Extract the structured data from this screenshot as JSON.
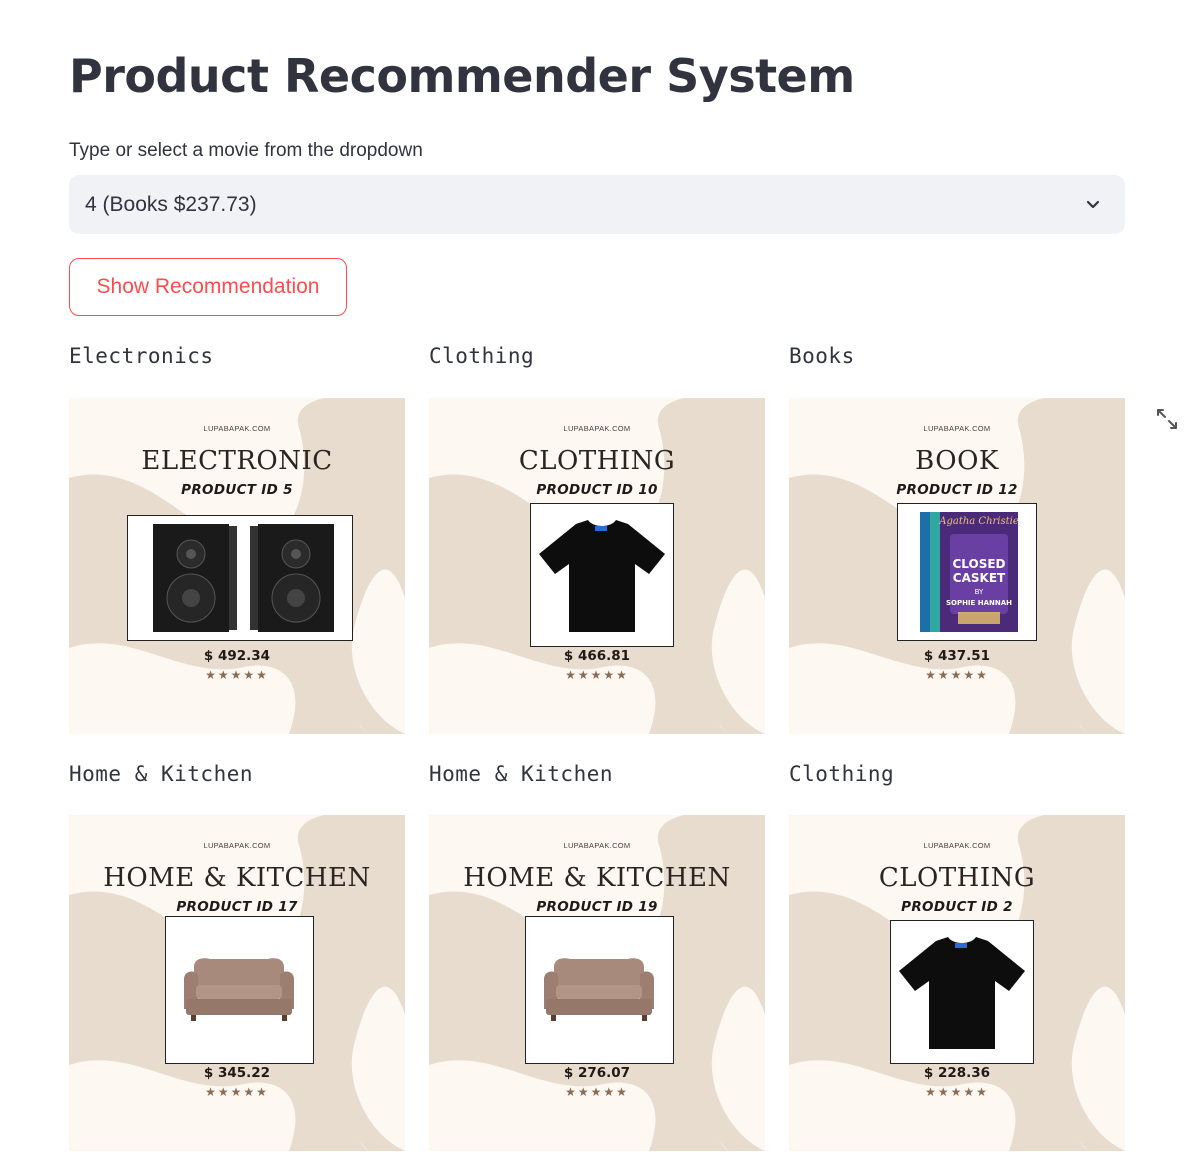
{
  "page": {
    "title": "Product Recommender System",
    "select_label": "Type or select a movie from the dropdown",
    "select_value": "4 (Books $237.73)",
    "button_label": "Show Recommendation"
  },
  "colors": {
    "accent": "#ff4b4b",
    "card_background": "#fdf8f2",
    "card_shape": "#e8dccf",
    "star": "#8a6b55"
  },
  "recommendations": [
    {
      "label": "Electronics",
      "site": "LUPABAPAK.COM",
      "category": "ELECTRONIC",
      "product_id": "PRODUCT ID 5",
      "price": "$ 492.34",
      "stars": "★★★★★",
      "image": "speakers"
    },
    {
      "label": "Clothing",
      "site": "LUPABAPAK.COM",
      "category": "CLOTHING",
      "product_id": "PRODUCT ID 10",
      "price": "$ 466.81",
      "stars": "★★★★★",
      "image": "t-shirt"
    },
    {
      "label": "Books",
      "site": "LUPABAPAK.COM",
      "category": "BOOK",
      "product_id": "PRODUCT ID 12",
      "price": "$ 437.51",
      "stars": "★★★★★",
      "image": "books",
      "book_author": "Agatha Christie",
      "book_title": "CLOSED CASKET",
      "book_by": "BY",
      "book_author2": "SOPHIE HANNAH"
    },
    {
      "label": "Home & Kitchen",
      "site": "LUPABAPAK.COM",
      "category": "HOME & KITCHEN",
      "product_id": "PRODUCT ID 17",
      "price": "$ 345.22",
      "stars": "★★★★★",
      "image": "sofa"
    },
    {
      "label": "Home & Kitchen",
      "site": "LUPABAPAK.COM",
      "category": "HOME & KITCHEN",
      "product_id": "PRODUCT ID 19",
      "price": "$ 276.07",
      "stars": "★★★★★",
      "image": "sofa"
    },
    {
      "label": "Clothing",
      "site": "LUPABAPAK.COM",
      "category": "CLOTHING",
      "product_id": "PRODUCT ID 2",
      "price": "$ 228.36",
      "stars": "★★★★★",
      "image": "t-shirt"
    }
  ],
  "icons": {
    "dropdown": "chevron-down-icon",
    "fullscreen": "expand-icon"
  }
}
